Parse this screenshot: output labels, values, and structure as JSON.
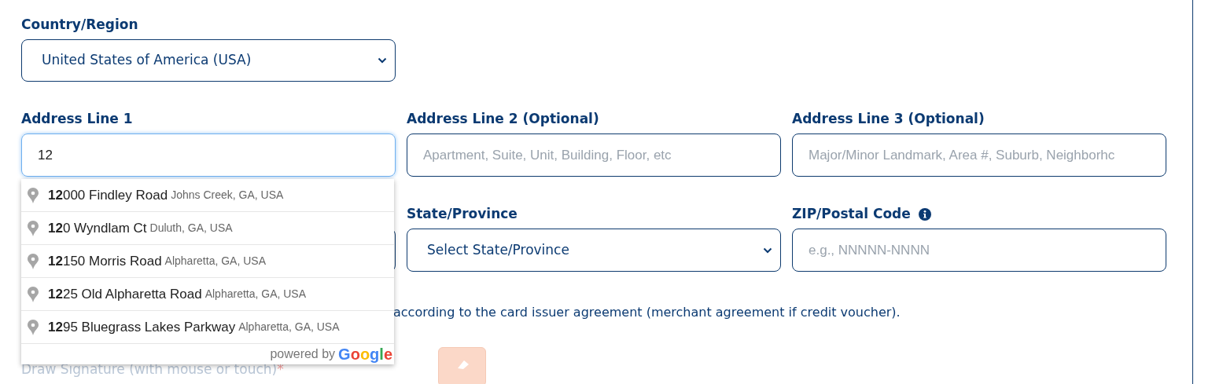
{
  "country": {
    "label": "Country/Region",
    "value": "United States of America (USA)"
  },
  "address_lines": [
    {
      "label": "Address Line 1",
      "value": "12",
      "focused": true
    },
    {
      "label": "Address Line 2 (Optional)",
      "placeholder": "Apartment, Suite, Unit, Building, Floor, etc",
      "focused": false
    },
    {
      "label": "Address Line 3 (Optional)",
      "placeholder": "Major/Minor Landmark, Area #, Suburb, Neighborhc",
      "focused": false
    }
  ],
  "state": {
    "label": "State/Province",
    "value": "Select State/Province"
  },
  "zip": {
    "label": "ZIP/Postal Code",
    "placeholder": "e.g., NNNNN-NNNN"
  },
  "suggestions": [
    {
      "main": "**12**000 Findley Road",
      "secondary": "Johns Creek, GA, USA"
    },
    {
      "main": "**12**0 Wyndlam Ct",
      "secondary": "Duluth, GA, USA"
    },
    {
      "main": "**12**150 Morris Road",
      "secondary": "Alpharetta, GA, USA"
    },
    {
      "main": "**12**25 Old Alpharetta Road",
      "secondary": "Alpharetta, GA, USA"
    },
    {
      "main": "**12**95 Bluegrass Lakes Parkway",
      "secondary": "Alpharetta, GA, USA"
    }
  ],
  "attribution": {
    "text": "powered by",
    "logo": "Google"
  },
  "agreement_text": "according to the card issuer agreement (merchant agreement if credit voucher).",
  "signature": {
    "label": "Draw Signature (with mouse or touch)",
    "required_mark": "*"
  }
}
